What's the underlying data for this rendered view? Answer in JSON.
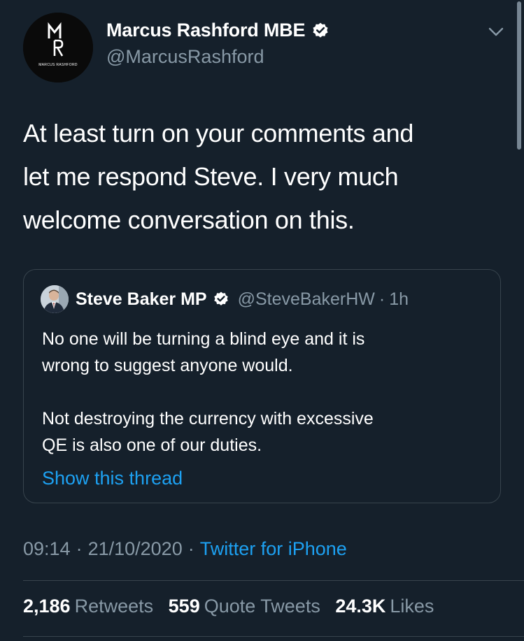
{
  "author": {
    "display_name": "Marcus Rashford MBE",
    "handle": "@MarcusRashford",
    "avatar_text": "MARCUS RASHFORD",
    "verified": true
  },
  "tweet": {
    "lines": [
      "At least turn on your comments and",
      "let me respond Steve. I very much",
      "welcome conversation on this."
    ]
  },
  "quoted": {
    "display_name": "Steve Baker MP",
    "handle": "@SteveBakerHW",
    "separator": "·",
    "time": "1h",
    "paragraph1": [
      "No one will be turning a blind eye and it is",
      "wrong to suggest anyone would."
    ],
    "paragraph2": [
      "Not destroying the currency with excessive",
      "QE is also one of our duties."
    ],
    "show_thread": "Show this thread"
  },
  "meta": {
    "time": "09:14",
    "date": "21/10/2020",
    "separator": "·",
    "source": "Twitter for iPhone"
  },
  "stats": {
    "retweets_count": "2,186",
    "retweets_label": "Retweets",
    "quotes_count": "559",
    "quotes_label": "Quote Tweets",
    "likes_count": "24.3K",
    "likes_label": "Likes"
  },
  "colors": {
    "background": "#15202b",
    "text": "#ffffff",
    "secondary": "#8899a6",
    "accent": "#1da1f2",
    "border": "#38444d"
  }
}
